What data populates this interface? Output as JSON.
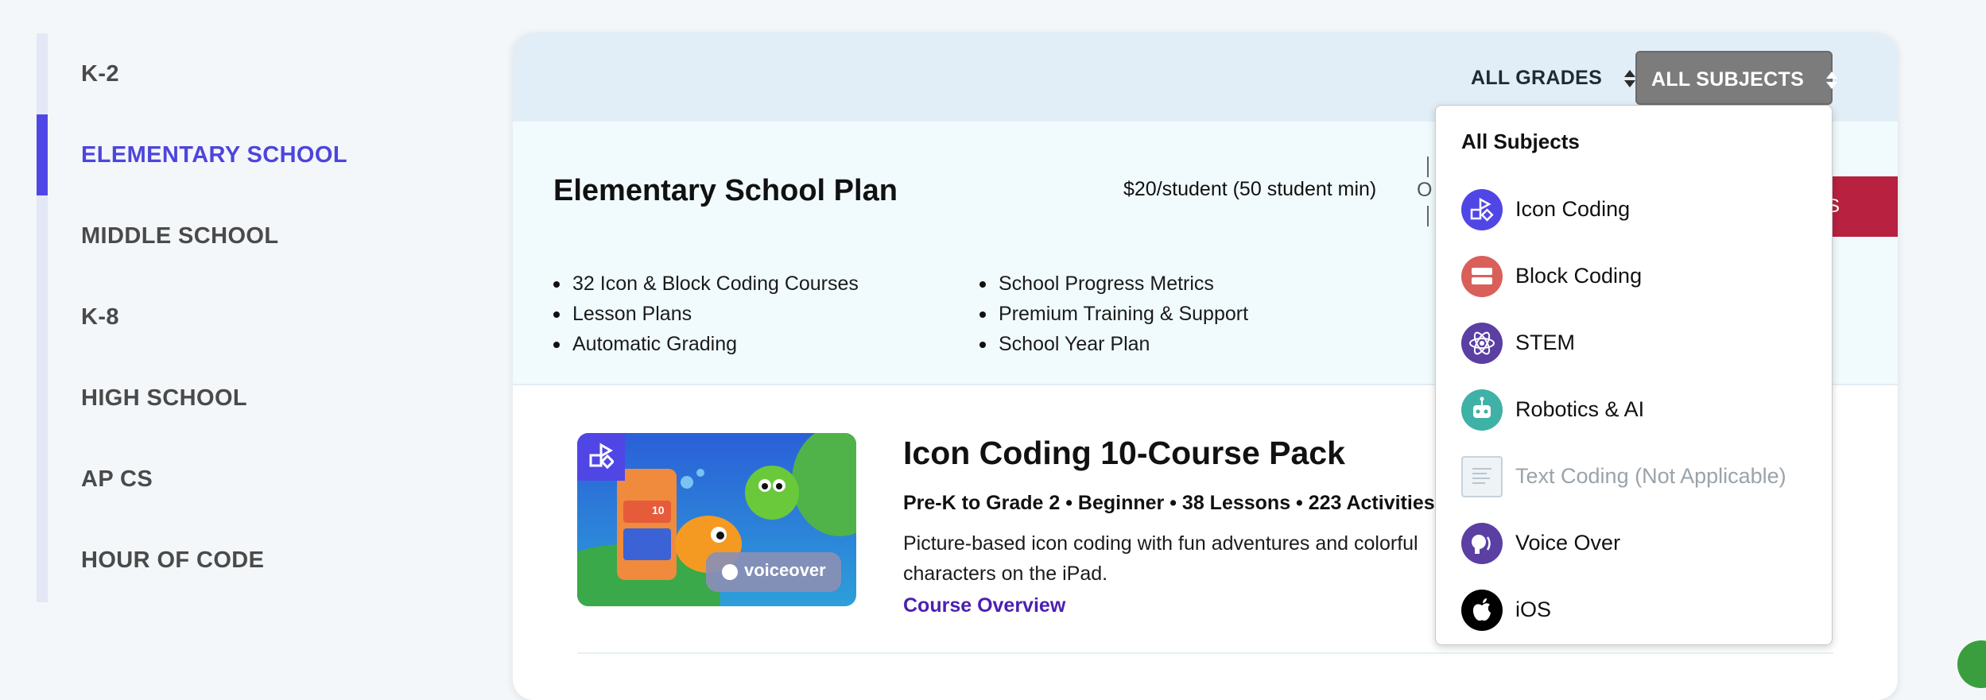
{
  "nav": {
    "items": [
      {
        "label": "K-2"
      },
      {
        "label": "ELEMENTARY SCHOOL",
        "active": true
      },
      {
        "label": "MIDDLE SCHOOL"
      },
      {
        "label": "K-8"
      },
      {
        "label": "HIGH SCHOOL"
      },
      {
        "label": "AP CS"
      },
      {
        "label": "HOUR OF CODE"
      }
    ],
    "active_color": "#5046e5"
  },
  "filters": {
    "grades_label": "ALL GRADES",
    "subjects_label": "ALL SUBJECTS"
  },
  "plan": {
    "title": "Elementary School Plan",
    "price": "$20/student (50 student min)",
    "or_text": "O",
    "pricing_button": "NGS",
    "features_left": [
      "32 Icon & Block Coding Courses",
      "Lesson Plans",
      "Automatic Grading"
    ],
    "features_right": [
      "School Progress Metrics",
      "Premium Training & Support",
      "School Year Plan"
    ]
  },
  "course": {
    "title": "Icon Coding 10-Course Pack",
    "meta": "Pre-K to Grade 2 • Beginner • 38 Lessons • 223 Activities",
    "desc": "Picture-based icon coding with fun adventures and colorful characters on the iPad.",
    "link": "Course Overview",
    "thumb_badge": "voiceover",
    "thumb_counter": "10"
  },
  "dropdown": {
    "header": "All Subjects",
    "items": [
      {
        "label": "Icon Coding",
        "icon": "icon-coding-icon",
        "color": "#5046e5"
      },
      {
        "label": "Block Coding",
        "icon": "block-coding-icon",
        "color": "#d9605a"
      },
      {
        "label": "STEM",
        "icon": "atom-icon",
        "color": "#5b3fa3"
      },
      {
        "label": "Robotics & AI",
        "icon": "robot-icon",
        "color": "#3fb1a6"
      },
      {
        "label": "Text Coding (Not Applicable)",
        "icon": "text-coding-icon",
        "disabled": true
      },
      {
        "label": "Voice Over",
        "icon": "voice-over-icon",
        "color": "#5b3fa3"
      },
      {
        "label": "iOS",
        "icon": "apple-icon",
        "color": "#000000"
      }
    ]
  }
}
